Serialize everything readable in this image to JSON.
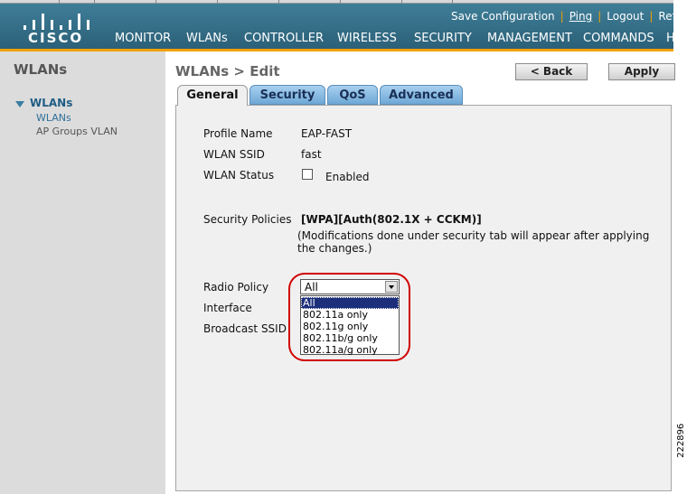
{
  "brand": {
    "name": "CISCO"
  },
  "utility_links": [
    "Save Configuration",
    "Ping",
    "Logout",
    "Refr"
  ],
  "nav": [
    "MONITOR",
    "WLANs",
    "CONTROLLER",
    "WIRELESS",
    "SECURITY",
    "MANAGEMENT",
    "COMMANDS",
    "H"
  ],
  "sidebar": {
    "title": "WLANs",
    "root": "WLANs",
    "items": [
      "WLANs",
      "AP Groups VLAN"
    ]
  },
  "main": {
    "breadcrumb": "WLANs > Edit",
    "back_label": "< Back",
    "apply_label": "Apply",
    "tabs": [
      "General",
      "Security",
      "QoS",
      "Advanced"
    ],
    "active_tab": "General"
  },
  "form": {
    "profile_name_label": "Profile Name",
    "profile_name_value": "EAP-FAST",
    "ssid_label": "WLAN SSID",
    "ssid_value": "fast",
    "status_label": "WLAN Status",
    "status_checkbox_label": "Enabled",
    "status_checked": false,
    "security_label": "Security Policies",
    "security_value": "[WPA][Auth(802.1X + CCKM)]",
    "security_note": "(Modifications done under security tab will appear after applying the changes.)",
    "radio_policy_label": "Radio Policy",
    "radio_policy_value": "All",
    "radio_policy_options": [
      "All",
      "802.11a only",
      "802.11g only",
      "802.11b/g only",
      "802.11a/g only"
    ],
    "interface_label": "Interface",
    "broadcast_label": "Broadcast SSID"
  },
  "figure_number": "222896",
  "colors": {
    "header": "#2b6078",
    "header_accent": "#f0a000",
    "selected_option": "#1d2f7b",
    "highlight": "#d00000"
  }
}
